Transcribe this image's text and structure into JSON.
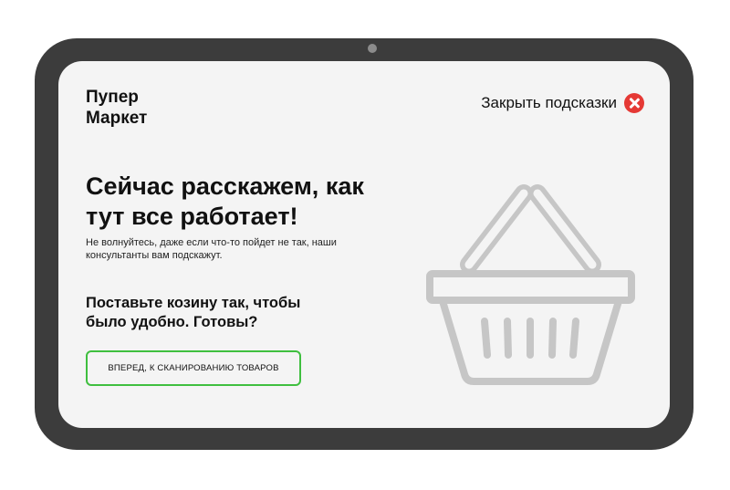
{
  "app": {
    "logo": "Пупер\nМаркет"
  },
  "header": {
    "close_hints_label": "Закрыть подсказки"
  },
  "main": {
    "headline": "Сейчас расскажем, как тут все работает!",
    "subtext": "Не волнуйтесь, даже если что-то пойдет не так, наши консультанты вам подскажут.",
    "prompt": "Поставьте козину так, чтобы было удобно. Готовы?",
    "cta_label": "ВПЕРЕД, К СКАНИРОВАНИЮ ТОВАРОВ"
  },
  "icons": {
    "close": "close-icon",
    "basket": "basket-icon"
  },
  "colors": {
    "bezel": "#3c3c3c",
    "screen": "#f4f4f4",
    "accent_green": "#3fbf3f",
    "close_red": "#e53935",
    "basket_gray": "#c6c6c6"
  }
}
